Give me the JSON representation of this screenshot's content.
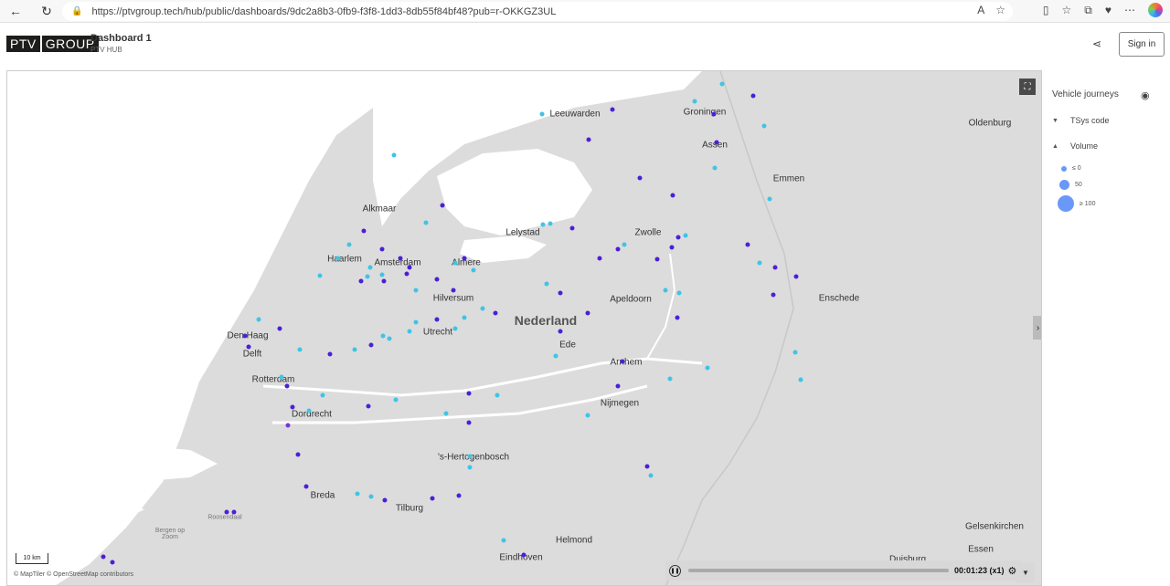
{
  "browser": {
    "url": "https://ptvgroup.tech/hub/public/dashboards/9dc2a8b3-0fb9-f3f8-1dd3-8db55f84bf48?pub=r-OKKGZ3UL"
  },
  "header": {
    "logo_left": "PTV",
    "logo_right": "GROUP",
    "title": "Dashboard 1",
    "subtitle": "PTV HUB",
    "signin_label": "Sign in"
  },
  "legend": {
    "title": "Vehicle journeys",
    "tsys_label": "TSys code",
    "volume_label": "Volume",
    "sizes": [
      {
        "label": "≤ 0"
      },
      {
        "label": "50"
      },
      {
        "label": "≥ 100"
      }
    ]
  },
  "map": {
    "scale_label": "10 km",
    "attribution": "© MapTiler © OpenStreetMap contributors",
    "cities": [
      {
        "name": "Nederland",
        "cls": "big"
      },
      {
        "name": "Alkmaar"
      },
      {
        "name": "Haarlem"
      },
      {
        "name": "Amsterdam"
      },
      {
        "name": "Almere"
      },
      {
        "name": "Lelystad"
      },
      {
        "name": "Zwolle"
      },
      {
        "name": "Hilversum"
      },
      {
        "name": "Apeldoorn"
      },
      {
        "name": "Den Haag"
      },
      {
        "name": "Delft"
      },
      {
        "name": "Utrecht"
      },
      {
        "name": "Ede"
      },
      {
        "name": "Rotterdam"
      },
      {
        "name": "Arnhem"
      },
      {
        "name": "Dordrecht"
      },
      {
        "name": "Nijmegen"
      },
      {
        "name": "Enschede"
      },
      {
        "name": "Emmen"
      },
      {
        "name": "Groningen"
      },
      {
        "name": "Assen"
      },
      {
        "name": "Leeuwarden"
      },
      {
        "name": "Oldenburg"
      },
      {
        "name": "'s-Hertogenbosch"
      },
      {
        "name": "Breda"
      },
      {
        "name": "Tilburg"
      },
      {
        "name": "Helmond"
      },
      {
        "name": "Eindhoven"
      },
      {
        "name": "Gelsenkirchen"
      },
      {
        "name": "Essen"
      },
      {
        "name": "Duisburg"
      },
      {
        "name": "Bergen op Zoom"
      },
      {
        "name": "Roosendaal"
      }
    ]
  },
  "playback": {
    "time": "00:01:23 (x1)"
  }
}
